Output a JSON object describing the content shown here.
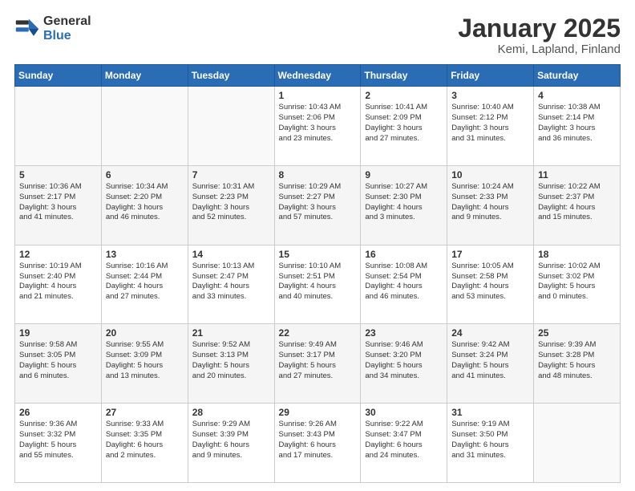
{
  "header": {
    "logo_general": "General",
    "logo_blue": "Blue",
    "title": "January 2025",
    "subtitle": "Kemi, Lapland, Finland"
  },
  "days_of_week": [
    "Sunday",
    "Monday",
    "Tuesday",
    "Wednesday",
    "Thursday",
    "Friday",
    "Saturday"
  ],
  "weeks": [
    [
      {
        "day": "",
        "info": ""
      },
      {
        "day": "",
        "info": ""
      },
      {
        "day": "",
        "info": ""
      },
      {
        "day": "1",
        "info": "Sunrise: 10:43 AM\nSunset: 2:06 PM\nDaylight: 3 hours\nand 23 minutes."
      },
      {
        "day": "2",
        "info": "Sunrise: 10:41 AM\nSunset: 2:09 PM\nDaylight: 3 hours\nand 27 minutes."
      },
      {
        "day": "3",
        "info": "Sunrise: 10:40 AM\nSunset: 2:12 PM\nDaylight: 3 hours\nand 31 minutes."
      },
      {
        "day": "4",
        "info": "Sunrise: 10:38 AM\nSunset: 2:14 PM\nDaylight: 3 hours\nand 36 minutes."
      }
    ],
    [
      {
        "day": "5",
        "info": "Sunrise: 10:36 AM\nSunset: 2:17 PM\nDaylight: 3 hours\nand 41 minutes."
      },
      {
        "day": "6",
        "info": "Sunrise: 10:34 AM\nSunset: 2:20 PM\nDaylight: 3 hours\nand 46 minutes."
      },
      {
        "day": "7",
        "info": "Sunrise: 10:31 AM\nSunset: 2:23 PM\nDaylight: 3 hours\nand 52 minutes."
      },
      {
        "day": "8",
        "info": "Sunrise: 10:29 AM\nSunset: 2:27 PM\nDaylight: 3 hours\nand 57 minutes."
      },
      {
        "day": "9",
        "info": "Sunrise: 10:27 AM\nSunset: 2:30 PM\nDaylight: 4 hours\nand 3 minutes."
      },
      {
        "day": "10",
        "info": "Sunrise: 10:24 AM\nSunset: 2:33 PM\nDaylight: 4 hours\nand 9 minutes."
      },
      {
        "day": "11",
        "info": "Sunrise: 10:22 AM\nSunset: 2:37 PM\nDaylight: 4 hours\nand 15 minutes."
      }
    ],
    [
      {
        "day": "12",
        "info": "Sunrise: 10:19 AM\nSunset: 2:40 PM\nDaylight: 4 hours\nand 21 minutes."
      },
      {
        "day": "13",
        "info": "Sunrise: 10:16 AM\nSunset: 2:44 PM\nDaylight: 4 hours\nand 27 minutes."
      },
      {
        "day": "14",
        "info": "Sunrise: 10:13 AM\nSunset: 2:47 PM\nDaylight: 4 hours\nand 33 minutes."
      },
      {
        "day": "15",
        "info": "Sunrise: 10:10 AM\nSunset: 2:51 PM\nDaylight: 4 hours\nand 40 minutes."
      },
      {
        "day": "16",
        "info": "Sunrise: 10:08 AM\nSunset: 2:54 PM\nDaylight: 4 hours\nand 46 minutes."
      },
      {
        "day": "17",
        "info": "Sunrise: 10:05 AM\nSunset: 2:58 PM\nDaylight: 4 hours\nand 53 minutes."
      },
      {
        "day": "18",
        "info": "Sunrise: 10:02 AM\nSunset: 3:02 PM\nDaylight: 5 hours\nand 0 minutes."
      }
    ],
    [
      {
        "day": "19",
        "info": "Sunrise: 9:58 AM\nSunset: 3:05 PM\nDaylight: 5 hours\nand 6 minutes."
      },
      {
        "day": "20",
        "info": "Sunrise: 9:55 AM\nSunset: 3:09 PM\nDaylight: 5 hours\nand 13 minutes."
      },
      {
        "day": "21",
        "info": "Sunrise: 9:52 AM\nSunset: 3:13 PM\nDaylight: 5 hours\nand 20 minutes."
      },
      {
        "day": "22",
        "info": "Sunrise: 9:49 AM\nSunset: 3:17 PM\nDaylight: 5 hours\nand 27 minutes."
      },
      {
        "day": "23",
        "info": "Sunrise: 9:46 AM\nSunset: 3:20 PM\nDaylight: 5 hours\nand 34 minutes."
      },
      {
        "day": "24",
        "info": "Sunrise: 9:42 AM\nSunset: 3:24 PM\nDaylight: 5 hours\nand 41 minutes."
      },
      {
        "day": "25",
        "info": "Sunrise: 9:39 AM\nSunset: 3:28 PM\nDaylight: 5 hours\nand 48 minutes."
      }
    ],
    [
      {
        "day": "26",
        "info": "Sunrise: 9:36 AM\nSunset: 3:32 PM\nDaylight: 5 hours\nand 55 minutes."
      },
      {
        "day": "27",
        "info": "Sunrise: 9:33 AM\nSunset: 3:35 PM\nDaylight: 6 hours\nand 2 minutes."
      },
      {
        "day": "28",
        "info": "Sunrise: 9:29 AM\nSunset: 3:39 PM\nDaylight: 6 hours\nand 9 minutes."
      },
      {
        "day": "29",
        "info": "Sunrise: 9:26 AM\nSunset: 3:43 PM\nDaylight: 6 hours\nand 17 minutes."
      },
      {
        "day": "30",
        "info": "Sunrise: 9:22 AM\nSunset: 3:47 PM\nDaylight: 6 hours\nand 24 minutes."
      },
      {
        "day": "31",
        "info": "Sunrise: 9:19 AM\nSunset: 3:50 PM\nDaylight: 6 hours\nand 31 minutes."
      },
      {
        "day": "",
        "info": ""
      }
    ]
  ]
}
